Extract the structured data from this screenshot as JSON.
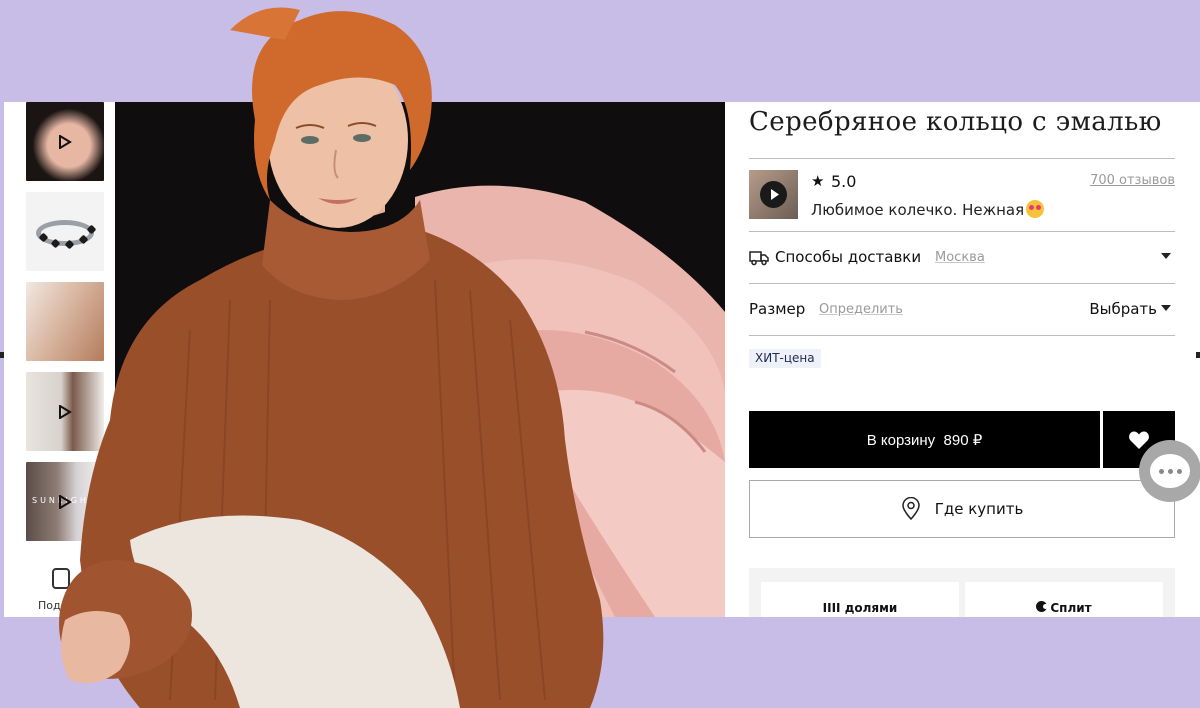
{
  "product": {
    "title": "Серебряное кольцо с эмалью"
  },
  "thumbnails": {
    "items": [
      "video-hand-ring",
      "ring-photo",
      "model-ear-photo",
      "video-interior",
      "video-brand"
    ],
    "brand_overlay": "SUNLIGHT",
    "more_label": "Под"
  },
  "review": {
    "rating": "5.0",
    "reviews_link": "700 отзывов",
    "text": "Любимое колечко. Нежная"
  },
  "delivery": {
    "label": "Способы доставки",
    "city": "Москва"
  },
  "size": {
    "label": "Размер",
    "define_link": "Определить",
    "choose_label": "Выбрать"
  },
  "badge": "ХИТ-цена",
  "actions": {
    "cart_label": "В корзину  890 ₽",
    "where_label": "Где купить"
  },
  "payments": {
    "dolyami": "IIII долями",
    "split": "Сплит"
  },
  "colors": {
    "background": "#c7bde6",
    "button": "#000000",
    "badge_bg": "#eef1f8",
    "sweater": "#9a4f2b",
    "hair": "#d06a2c"
  },
  "icons": [
    "play-icon",
    "star-icon",
    "truck-icon",
    "caret-down-icon",
    "heart-icon",
    "location-pin-icon",
    "chat-icon"
  ]
}
